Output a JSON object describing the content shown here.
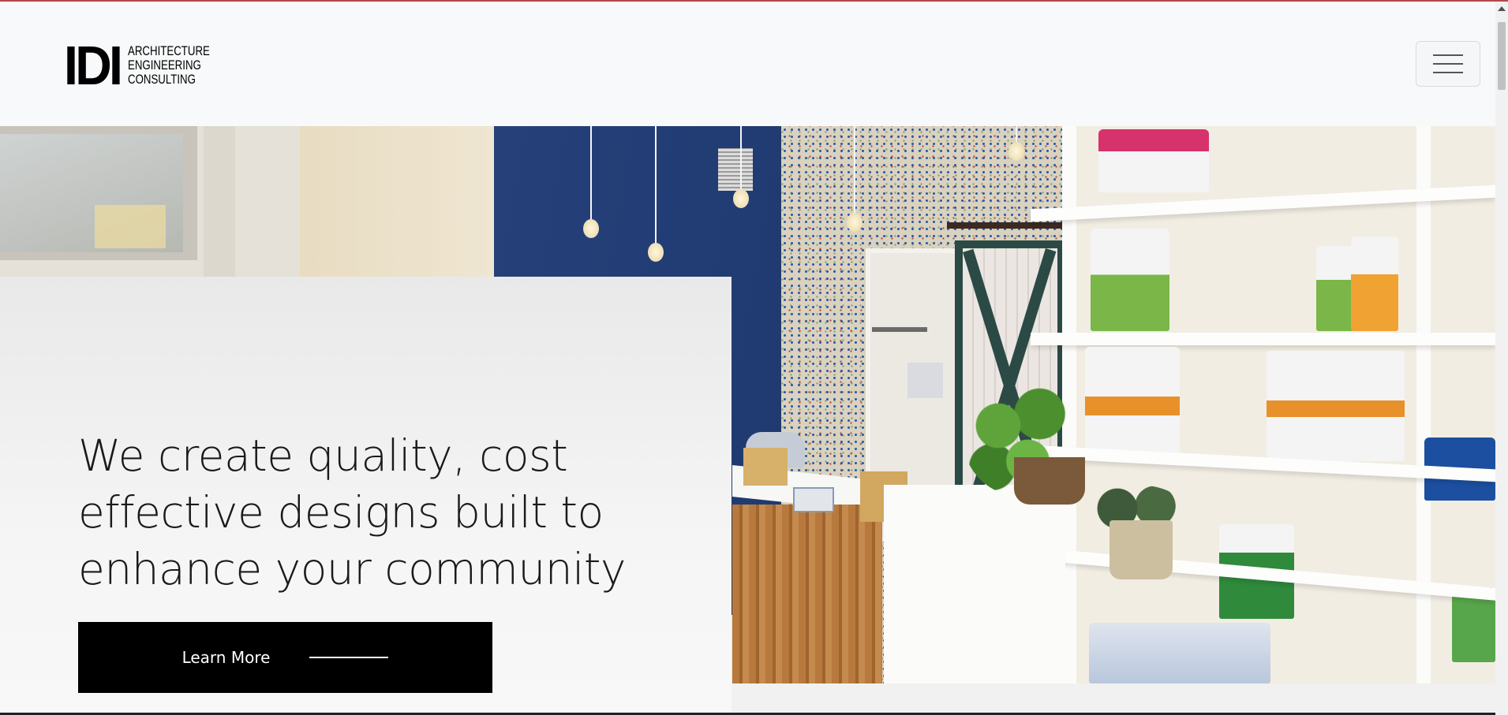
{
  "header": {
    "logo": {
      "mark": "IDI",
      "lines": [
        "ARCHITECTURE",
        "ENGINEERING",
        "CONSULTING"
      ]
    },
    "menu_icon": "hamburger-menu-icon"
  },
  "hero": {
    "image_alt": "",
    "heading": "We create quality, cost effective designs built to enhance your community",
    "cta_label": "Learn More",
    "cta_icon": "long-arrow-line-icon"
  },
  "colors": {
    "accent_top": "#b5474b",
    "cta_background": "#000000",
    "card_background": "#f2f2f2"
  }
}
